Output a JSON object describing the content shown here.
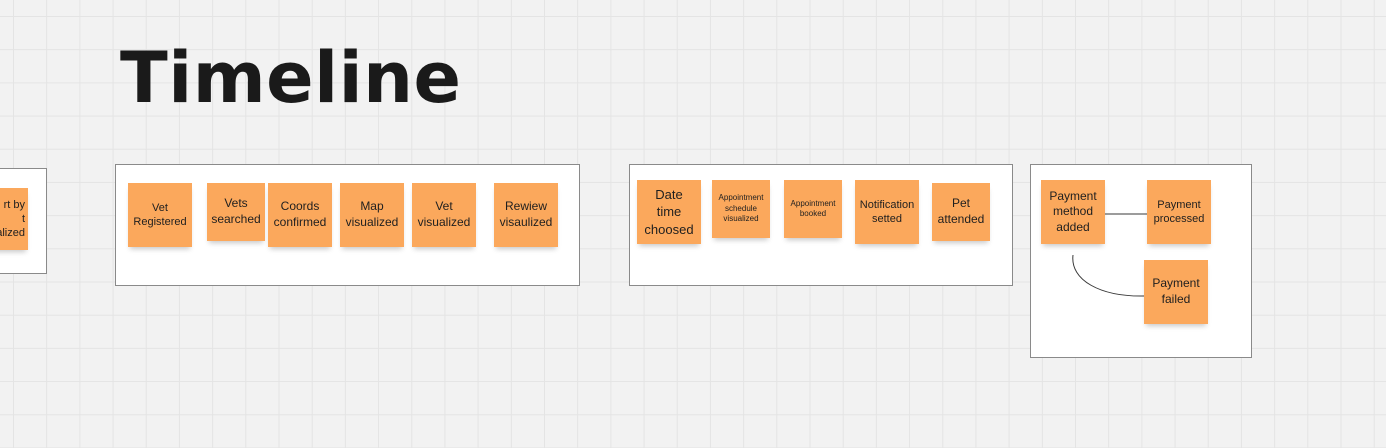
{
  "board": {
    "title": "Timeline",
    "colors": {
      "sticky_fill": "#fba85c",
      "frame_border": "#8a8a8a",
      "canvas": "#f2f2f2"
    }
  },
  "partial_frame": {
    "sticky_text": "rt by\nt\nalized"
  },
  "frame_1": {
    "stickies": [
      "Vet\nRegistered",
      "Vets\nsearched",
      "Coords\nconfirmed",
      "Map\nvisualized",
      "Vet\nvisualized",
      "Rewiew\nvisaulized"
    ]
  },
  "frame_2": {
    "stickies": [
      "Date\ntime\nchoosed",
      "Appointment\nschedule\nvisualized",
      "Appointment\nbooked",
      "Notification\nsetted",
      "Pet\nattended"
    ]
  },
  "frame_3": {
    "stickies": [
      "Payment\nmethod\nadded",
      "Payment\nprocessed",
      "Payment\nfailed"
    ]
  }
}
